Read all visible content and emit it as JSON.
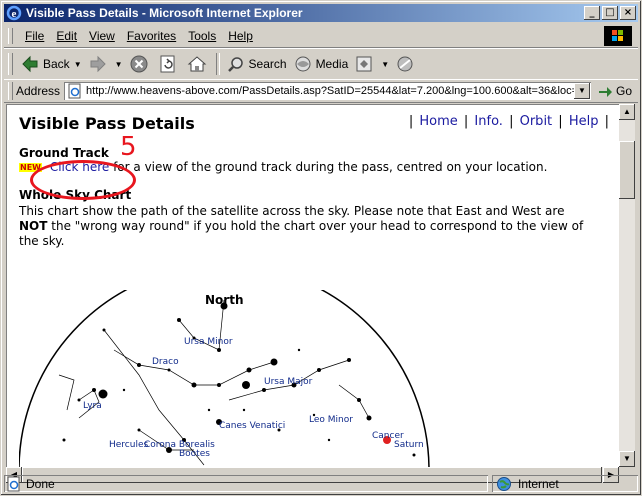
{
  "window": {
    "title": "Visible Pass Details - Microsoft Internet Explorer",
    "controls": {
      "minimize": "_",
      "maximize": "□",
      "close": "×"
    }
  },
  "menu": [
    "File",
    "Edit",
    "View",
    "Favorites",
    "Tools",
    "Help"
  ],
  "toolbar": {
    "back": "Back",
    "search": "Search",
    "media": "Media"
  },
  "address": {
    "label": "Address",
    "url": "http://www.heavens-above.com/PassDetails.asp?SatID=25544&lat=7.200&lng=100.600&alt=36&loc=S",
    "go": "Go"
  },
  "page": {
    "title": "Visible Pass Details",
    "nav": [
      "Home",
      "Info.",
      "Orbit",
      "Help"
    ],
    "ground_track": {
      "heading": "Ground Track",
      "badge": "NEW",
      "link": "Click here",
      "text": " for a view of the ground track during the pass, centred on your location."
    },
    "sky": {
      "heading": "Whole Sky Chart",
      "line1": "This chart show the path of the satellite across the sky. Please note that East and West are",
      "bold": "NOT",
      "line2": " the \"wrong way round\" if you hold the chart over your head to correspond to the view of",
      "line3": "the sky."
    },
    "chart": {
      "north": "North",
      "labels": [
        "Ursa Minor",
        "Draco",
        "Ursa Major",
        "Lyra",
        "Canes Venatici",
        "Leo Minor",
        "Cancer",
        "Saturn",
        "Hercules",
        "Corona Borealis",
        "Bootes"
      ]
    },
    "annotation": "5"
  },
  "status": {
    "text": "Done",
    "zone": "Internet"
  }
}
